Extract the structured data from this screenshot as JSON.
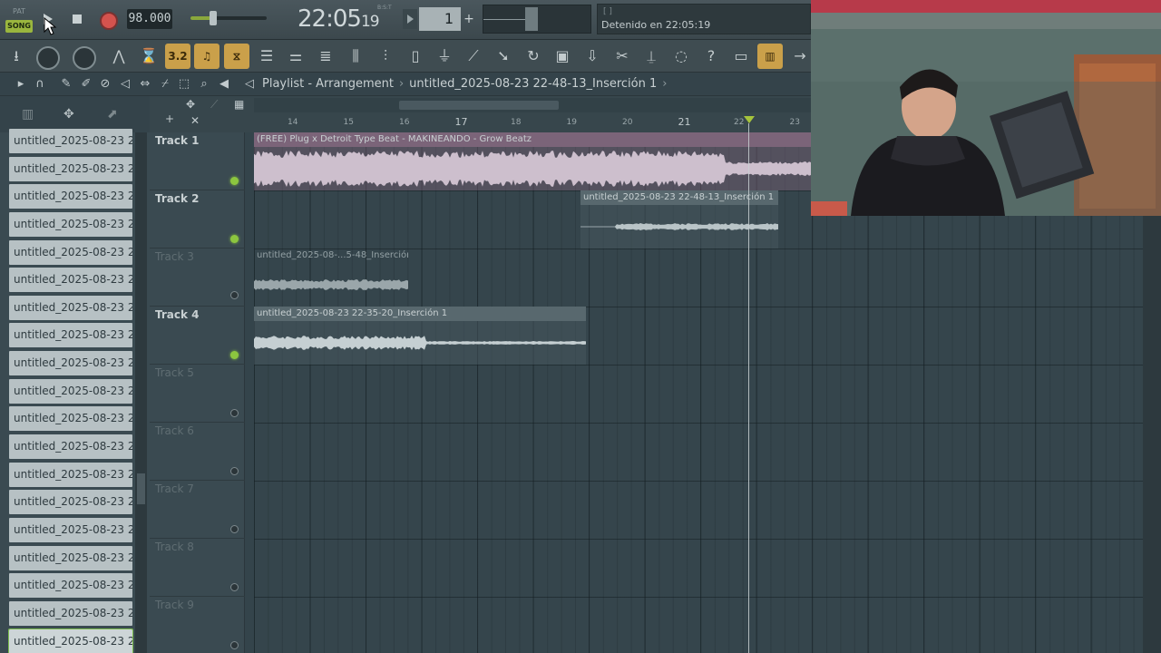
{
  "transport": {
    "pat_label": "PAT",
    "song_label": "SONG",
    "tempo": "98.000",
    "master_volume_fraction": 0.3,
    "clock_main": "22:05",
    "clock_secs": "19",
    "clock_unit": "B:S:T",
    "pattern_number": "1",
    "pattern_add": "+",
    "hint_brackets": "[ ]",
    "hint_text": "Detenido en 22:05:19"
  },
  "toolbar": {
    "tools": [
      "download-icon",
      "knob-icon",
      "knob-icon",
      "tempo-tap-icon",
      "metronome-icon",
      "blend-notes-icon",
      "piano-plus-icon",
      "wait-icon",
      "mixer-strip-icon",
      "step-seq-icon",
      "playlist-icon",
      "mixer-icon",
      "channel-rack-icon",
      "file-icon",
      "plugin-icon",
      "wand-icon",
      "pointer-arrow-icon",
      "refresh-icon",
      "save-icon",
      "export-icon",
      "cut-icon",
      "mic-icon",
      "chat-icon",
      "help-icon",
      "window-icon",
      "piano-icon",
      "arrow-right-icon"
    ],
    "orange_label": "3.2"
  },
  "playlist": {
    "title": "Playlist - Arrangement",
    "pattern": "untitled_2025-08-23 22-48-13_Inserción 1"
  },
  "browser": {
    "items": [
      "untitled_2025-08-23 22...",
      "untitled_2025-08-23 22...",
      "untitled_2025-08-23 22...",
      "untitled_2025-08-23 22...",
      "untitled_2025-08-23 22...",
      "untitled_2025-08-23 22...",
      "untitled_2025-08-23 22...",
      "untitled_2025-08-23 22...",
      "untitled_2025-08-23 22...",
      "untitled_2025-08-23 22...",
      "untitled_2025-08-23 22...",
      "untitled_2025-08-23 22...",
      "untitled_2025-08-23 22...",
      "untitled_2025-08-23 22...",
      "untitled_2025-08-23 22...",
      "untitled_2025-08-23 22...",
      "untitled_2025-08-23 22...",
      "untitled_2025-08-23 22...",
      "untitled_2025-08-23 22..."
    ]
  },
  "tracks": [
    {
      "name": "Track 1",
      "muted": false
    },
    {
      "name": "Track 2",
      "muted": false
    },
    {
      "name": "Track 3",
      "muted": true
    },
    {
      "name": "Track 4",
      "muted": false
    },
    {
      "name": "Track 5",
      "muted": true
    },
    {
      "name": "Track 6",
      "muted": true
    },
    {
      "name": "Track 7",
      "muted": true
    },
    {
      "name": "Track 8",
      "muted": true
    },
    {
      "name": "Track 9",
      "muted": true
    }
  ],
  "ruler": [
    "14",
    "15",
    "16",
    "17",
    "18",
    "19",
    "20",
    "21",
    "22",
    "23"
  ],
  "clips": [
    {
      "track": 1,
      "title": "(FREE) Plug x Detroit Type Beat - MAKINEANDO - Grow Beatz"
    },
    {
      "track": 2,
      "title": "untitled_2025-08-23 22-48-13_Inserción 1"
    },
    {
      "track": 3,
      "title": "untitled_2025-08-...5-48_Inserción 1"
    },
    {
      "track": 4,
      "title": "untitled_2025-08-23 22-35-20_Inserción 1"
    }
  ],
  "colors": {
    "accent_green": "#8cc63f",
    "clip_purple": "#7b6479",
    "record_red": "#d4534e"
  }
}
